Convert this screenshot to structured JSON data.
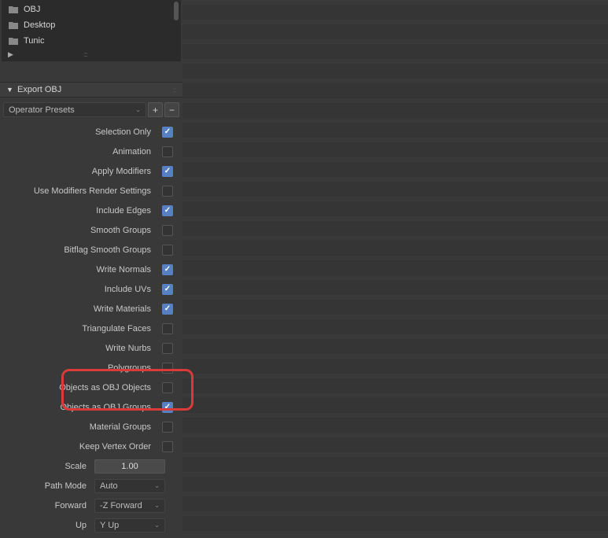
{
  "bookmarks": {
    "items": [
      {
        "label": "OBJ"
      },
      {
        "label": "Desktop"
      },
      {
        "label": "Tunic"
      }
    ]
  },
  "panel": {
    "title": "Export OBJ",
    "presets_label": "Operator Presets",
    "plus_label": "+",
    "minus_label": "−"
  },
  "options": [
    {
      "label": "Selection Only",
      "checked": true
    },
    {
      "label": "Animation",
      "checked": false
    },
    {
      "label": "Apply Modifiers",
      "checked": true
    },
    {
      "label": "Use Modifiers Render Settings",
      "checked": false
    },
    {
      "label": "Include Edges",
      "checked": true
    },
    {
      "label": "Smooth Groups",
      "checked": false
    },
    {
      "label": "Bitflag Smooth Groups",
      "checked": false
    },
    {
      "label": "Write Normals",
      "checked": true
    },
    {
      "label": "Include UVs",
      "checked": true
    },
    {
      "label": "Write Materials",
      "checked": true
    },
    {
      "label": "Triangulate Faces",
      "checked": false
    },
    {
      "label": "Write Nurbs",
      "checked": false
    },
    {
      "label": "Polygroups",
      "checked": false
    },
    {
      "label": "Objects as OBJ Objects",
      "checked": false
    },
    {
      "label": "Objects as OBJ Groups",
      "checked": true
    },
    {
      "label": "Material Groups",
      "checked": false
    },
    {
      "label": "Keep Vertex Order",
      "checked": false
    }
  ],
  "scale": {
    "label": "Scale",
    "value": "1.00"
  },
  "path_mode": {
    "label": "Path Mode",
    "value": "Auto"
  },
  "forward": {
    "label": "Forward",
    "value": "-Z Forward"
  },
  "up": {
    "label": "Up",
    "value": "Y Up"
  }
}
